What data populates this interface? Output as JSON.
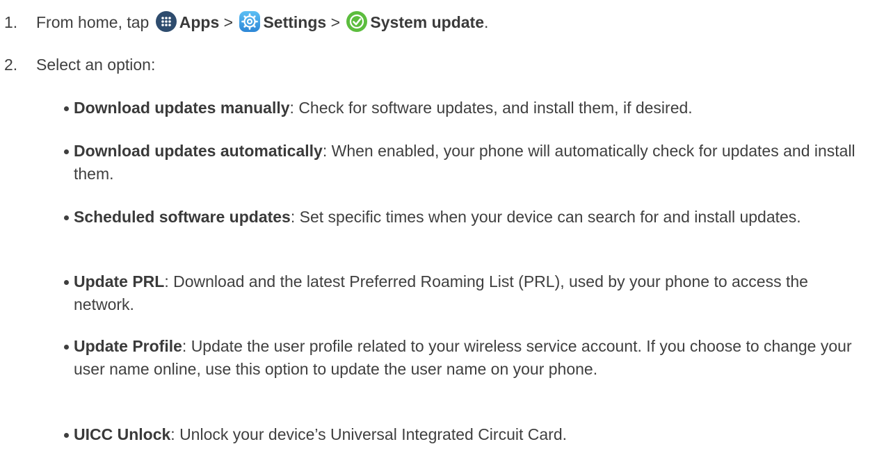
{
  "steps": [
    {
      "number": "1.",
      "prefix": "From home, tap",
      "apps_label": "Apps",
      "sep1": ">",
      "settings_label": "Settings",
      "sep2": ">",
      "system_update_label": "System update",
      "end": "."
    },
    {
      "number": "2.",
      "text": "Select an option:"
    }
  ],
  "options": [
    {
      "term": "Download updates manually",
      "desc": ": Check for software updates, and install them, if desired."
    },
    {
      "term": "Download updates automatically",
      "desc": ": When enabled, your phone will automatically check for updates and install them."
    },
    {
      "term": "Scheduled software updates",
      "desc": ": Set specific times when your device can search for and install updates."
    },
    {
      "term": "Update PRL",
      "desc": ": Download and the latest Preferred Roaming List (PRL), used by your phone to access the network."
    },
    {
      "term": "Update Profile",
      "desc": ": Update the user profile related to your wireless service account. If you choose to change your user name online, use this option to update the user name on your phone."
    },
    {
      "term": "UICC Unlock",
      "desc": ": Unlock your device’s Universal Integrated Circuit Card."
    }
  ],
  "icons": {
    "apps": "apps-grid-icon",
    "settings": "settings-gear-icon",
    "system_update": "check-circle-icon"
  },
  "colors": {
    "text": "#3f3f3f",
    "apps_icon": "#2e4c6e",
    "settings_icon": "#3aa0e6",
    "update_icon": "#5cbd3e"
  }
}
